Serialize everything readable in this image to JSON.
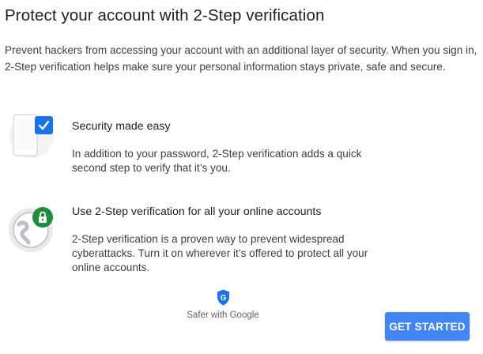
{
  "page": {
    "title": "Protect your account with 2-Step verification",
    "intro": "Prevent hackers from accessing your account with an additional layer of security. When you sign in, 2-Step verification helps make sure your personal information stays private, safe and secure."
  },
  "features": [
    {
      "icon": "phone-checkmark-icon",
      "title": "Security made easy",
      "description": "In addition to your password, 2-Step verification adds a quick second step to verify that it’s you."
    },
    {
      "icon": "globe-lock-icon",
      "title": "Use 2-Step verification for all your online accounts",
      "description": "2-Step verification is a proven way to prevent widespread cyberattacks. Turn it on wherever it’s offered to protect all your online accounts."
    }
  ],
  "badge": {
    "icon": "google-shield-icon",
    "letter": "G",
    "text": "Safer with Google"
  },
  "cta": {
    "label": "GET STARTED"
  },
  "colors": {
    "accent": "#4285f4",
    "lock_green": "#1e8e3e",
    "shield_blue": "#1a73e8"
  }
}
